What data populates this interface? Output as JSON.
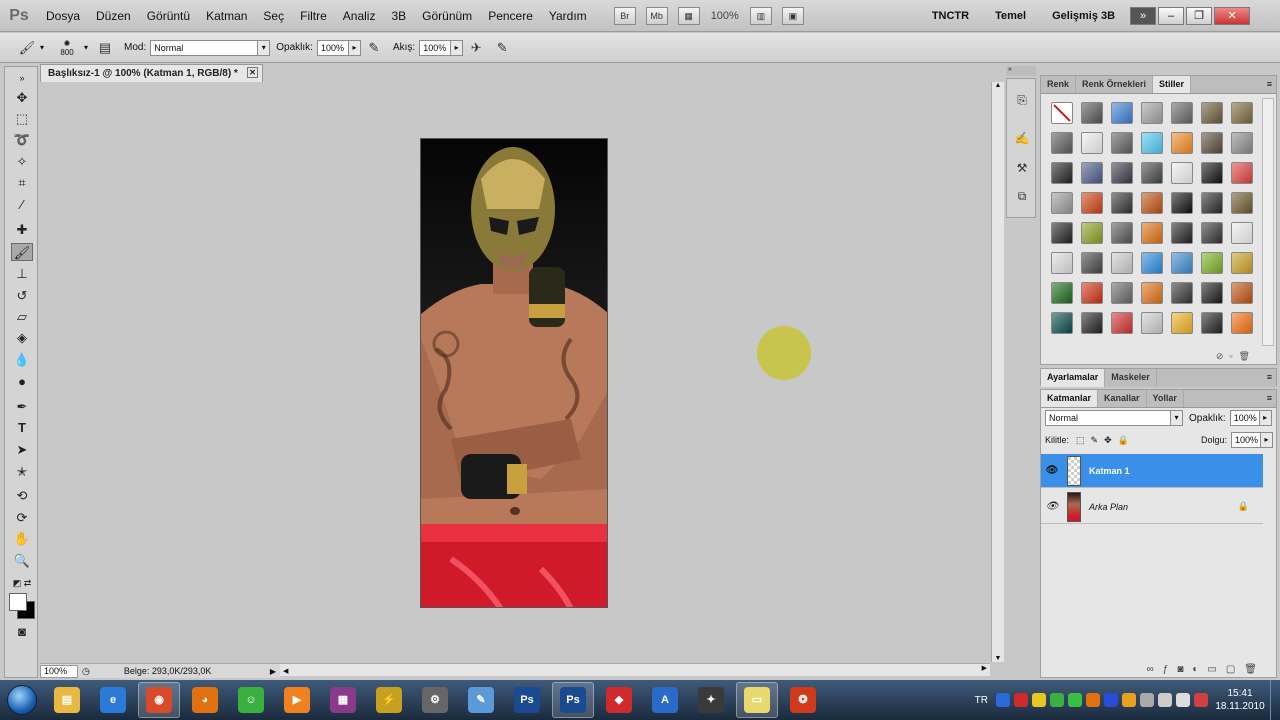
{
  "app": {
    "logo": "Ps"
  },
  "menubar": {
    "items": [
      "Dosya",
      "Düzen",
      "Görüntü",
      "Katman",
      "Seç",
      "Filtre",
      "Analiz",
      "3B",
      "Görünüm",
      "Pencere",
      "Yardım"
    ],
    "bridge": "Br",
    "minibridge": "Mb",
    "zoom": "100%",
    "workspaces": [
      "TNCTR",
      "Temel",
      "Gelişmiş 3B"
    ],
    "more": "»",
    "win_minimize": "–",
    "win_restore": "❐",
    "win_close": "✕"
  },
  "options": {
    "brush_size": "800",
    "mode_label": "Mod:",
    "mode_value": "Normal",
    "opacity_label": "Opaklık:",
    "opacity_value": "100%",
    "flow_label": "Akış:",
    "flow_value": "100%"
  },
  "document": {
    "tab_title": "Başlıksız-1 @ 100% (Katman 1, RGB/8) *",
    "close": "✕",
    "zoom": "100%",
    "status": "Belge: 293,0K/293,0K"
  },
  "styles_panel": {
    "tabs": [
      "Renk",
      "Renk Örnekleri",
      "Stiller"
    ],
    "active_tab": 2,
    "swatch_colors": [
      "#ffffff",
      "#555555",
      "#3a7fd0",
      "#a0a0a0",
      "#666666",
      "#6b5a3a",
      "#7a6a3a",
      "#5a5a5a",
      "#eeeeee",
      "#5d5d5d",
      "#4fc8f0",
      "#f08a20",
      "#5a4a3a",
      "#8a8a8a",
      "#222222",
      "#4a5a8a",
      "#3a3a4a",
      "#444444",
      "#eeeeee",
      "#111111",
      "#e04040",
      "#999999",
      "#d04010",
      "#333333",
      "#c05010",
      "#111111",
      "#2a2a2a",
      "#6a5a2a",
      "#222222",
      "#8aa020",
      "#555555",
      "#e07010",
      "#222222",
      "#333333",
      "#eeeeee",
      "#dddddd",
      "#444444",
      "#cccccc",
      "#2a8ae0",
      "#3a8ad0",
      "#7ab020",
      "#c8a020",
      "#1a6a1a",
      "#d03010",
      "#666666",
      "#e07010",
      "#333333",
      "#1a1a1a",
      "#c05010",
      "#0a4a4a",
      "#222222",
      "#d03030",
      "#cccccc",
      "#f0b020",
      "#222222",
      "#f07010"
    ]
  },
  "adjust_panel": {
    "tabs": [
      "Ayarlamalar",
      "Maskeler"
    ]
  },
  "layers_panel": {
    "tabs": [
      "Katmanlar",
      "Kanallar",
      "Yollar"
    ],
    "blend_mode": "Normal",
    "opacity_label": "Opaklık:",
    "opacity_value": "100%",
    "lock_label": "Kilitle:",
    "fill_label": "Dolgu:",
    "fill_value": "100%",
    "layers": [
      {
        "name": "Katman 1",
        "selected": true
      },
      {
        "name": "Arka Plan",
        "selected": false,
        "locked": true
      }
    ]
  },
  "taskbar": {
    "apps": [
      {
        "icon": "file-explorer-icon",
        "color": "#e8b840",
        "glyph": "▤"
      },
      {
        "icon": "internet-explorer-icon",
        "color": "#2a7ad8",
        "glyph": "e"
      },
      {
        "icon": "chrome-icon",
        "color": "#d84a2a",
        "glyph": "◉",
        "active": true
      },
      {
        "icon": "firefox-icon",
        "color": "#e07010",
        "glyph": "◕"
      },
      {
        "icon": "messenger-icon",
        "color": "#3ab040",
        "glyph": "☺"
      },
      {
        "icon": "media-player-icon",
        "color": "#f08020",
        "glyph": "▶"
      },
      {
        "icon": "winrar-icon",
        "color": "#8a3a8a",
        "glyph": "▦"
      },
      {
        "icon": "utility-icon",
        "color": "#c8a020",
        "glyph": "⚡"
      },
      {
        "icon": "settings-tool-icon",
        "color": "#666666",
        "glyph": "⚙"
      },
      {
        "icon": "paint-icon",
        "color": "#5a9ad8",
        "glyph": "✎"
      },
      {
        "icon": "photoshop-icon",
        "color": "#1a4a90",
        "glyph": "Ps"
      },
      {
        "icon": "photoshop-active-icon",
        "color": "#1a4a90",
        "glyph": "Ps",
        "active": true
      },
      {
        "icon": "spreadsheet-icon",
        "color": "#d02a2a",
        "glyph": "◆"
      },
      {
        "icon": "avast-icon",
        "color": "#2a6ac8",
        "glyph": "A"
      },
      {
        "icon": "game-icon",
        "color": "#3a3a3a",
        "glyph": "✦"
      },
      {
        "icon": "sticky-notes-icon",
        "color": "#e8d870",
        "glyph": "▭",
        "active": true
      },
      {
        "icon": "browser-icon",
        "color": "#d03a1a",
        "glyph": "❂"
      }
    ],
    "tray_lang": "TR",
    "time": "15:41",
    "date": "18.11.2010"
  }
}
